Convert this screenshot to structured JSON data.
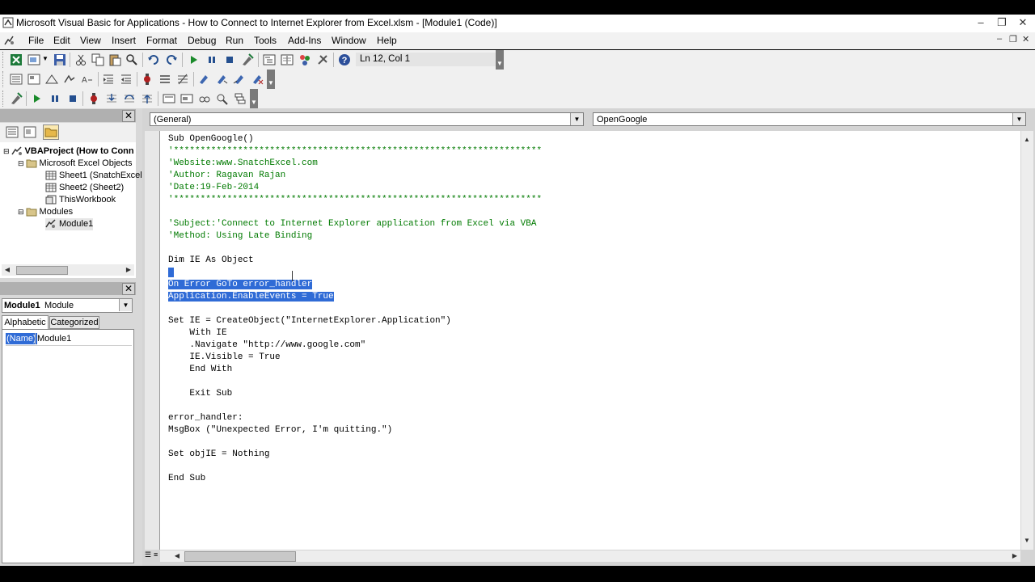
{
  "window": {
    "title": "Microsoft Visual Basic for Applications - How to Connect to Internet Explorer from Excel.xlsm - [Module1 (Code)]"
  },
  "menu": {
    "items": [
      "File",
      "Edit",
      "View",
      "Insert",
      "Format",
      "Debug",
      "Run",
      "Tools",
      "Add-Ins",
      "Window",
      "Help"
    ]
  },
  "toolbar": {
    "cursor_position": "Ln 12, Col 1"
  },
  "project_explorer": {
    "tree": [
      {
        "label": "VBAProject (How to Conn",
        "icon": "vba-project-icon",
        "bold": true
      },
      {
        "label": "Microsoft Excel Objects",
        "icon": "folder-icon"
      },
      {
        "label": "Sheet1 (SnatchExcel",
        "icon": "sheet-icon"
      },
      {
        "label": "Sheet2 (Sheet2)",
        "icon": "sheet-icon"
      },
      {
        "label": "ThisWorkbook",
        "icon": "workbook-icon"
      },
      {
        "label": "Modules",
        "icon": "folder-icon"
      },
      {
        "label": "Module1",
        "icon": "module-icon"
      }
    ]
  },
  "properties": {
    "object_name": "Module1",
    "object_type": "Module",
    "tabs": [
      "Alphabetic",
      "Categorized"
    ],
    "rows": [
      {
        "name": "(Name)",
        "value": "Module1"
      }
    ]
  },
  "code_window": {
    "object_combo": "(General)",
    "procedure_combo": "OpenGoogle",
    "lines": [
      {
        "text": "Sub OpenGoogle()",
        "type": "code"
      },
      {
        "text": "'*********************************************************************",
        "type": "comment"
      },
      {
        "text": "'Website:www.SnatchExcel.com",
        "type": "comment"
      },
      {
        "text": "'Author: Ragavan Rajan",
        "type": "comment"
      },
      {
        "text": "'Date:19-Feb-2014",
        "type": "comment"
      },
      {
        "text": "'*********************************************************************",
        "type": "comment"
      },
      {
        "text": "",
        "type": "code"
      },
      {
        "text": "'Subject:'Connect to Internet Explorer application from Excel via VBA",
        "type": "comment"
      },
      {
        "text": "'Method: Using Late Binding",
        "type": "comment"
      },
      {
        "text": "",
        "type": "code"
      },
      {
        "text": "Dim IE As Object",
        "type": "code"
      },
      {
        "text": " ",
        "type": "selected"
      },
      {
        "text": "On Error GoTo error_handler",
        "type": "selected"
      },
      {
        "text": "Application.EnableEvents = True",
        "type": "selected"
      },
      {
        "text": "",
        "type": "code"
      },
      {
        "text": "Set IE = CreateObject(\"InternetExplorer.Application\")",
        "type": "code"
      },
      {
        "text": "    With IE",
        "type": "code"
      },
      {
        "text": "    .Navigate \"http://www.google.com\"",
        "type": "code"
      },
      {
        "text": "    IE.Visible = True",
        "type": "code"
      },
      {
        "text": "    End With",
        "type": "code"
      },
      {
        "text": "",
        "type": "code"
      },
      {
        "text": "    Exit Sub",
        "type": "code"
      },
      {
        "text": "",
        "type": "code"
      },
      {
        "text": "error_handler:",
        "type": "code"
      },
      {
        "text": "MsgBox (\"Unexpected Error, I'm quitting.\")",
        "type": "code"
      },
      {
        "text": "",
        "type": "code"
      },
      {
        "text": "Set objIE = Nothing",
        "type": "code"
      },
      {
        "text": "",
        "type": "code"
      },
      {
        "text": "End Sub",
        "type": "code"
      }
    ]
  },
  "colors": {
    "comment": "#007a00",
    "selection": "#2f6bd6"
  }
}
